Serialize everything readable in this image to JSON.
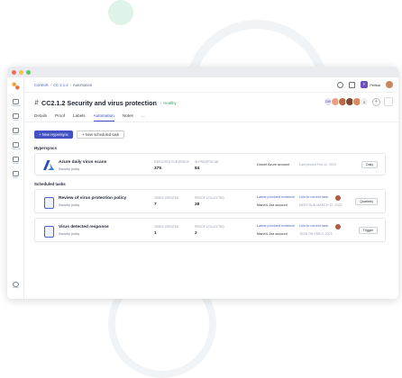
{
  "breadcrumb": {
    "controls": "Controls",
    "control": "CC 2.1.2",
    "current": "Automation"
  },
  "sidebar": {
    "items": [
      {
        "label": "Dashboard",
        "icon": "home-icon"
      },
      {
        "label": "Controls",
        "icon": "shield-icon"
      },
      {
        "label": "Evidence",
        "icon": "folder-icon"
      },
      {
        "label": "Documents",
        "icon": "document-icon"
      },
      {
        "label": "Vendors",
        "icon": "box-icon"
      },
      {
        "label": "Audits",
        "icon": "audit-icon"
      },
      {
        "label": "Settings",
        "icon": "gear-icon"
      }
    ]
  },
  "topbar": {
    "org_badge": "P",
    "org_name": "Pelikai"
  },
  "header": {
    "title": "CC2.1.2 Security and virus protection",
    "status": "Healthy",
    "initials": "DW",
    "more_count": "3"
  },
  "tabs": [
    {
      "label": "Details",
      "active": false
    },
    {
      "label": "Proof",
      "active": false
    },
    {
      "label": "Labels",
      "active": false
    },
    {
      "label": "Automation",
      "active": true
    },
    {
      "label": "Notes",
      "active": false
    },
    {
      "label": "...",
      "active": false
    }
  ],
  "buttons": {
    "new_hypersync": "+ New Hypersync",
    "new_scheduled": "+ New scheduled task"
  },
  "sections": {
    "hypersyncs": "Hypersyncs",
    "scheduled": "Scheduled tasks"
  },
  "hypersync": {
    "name": "Azure daily virus scans",
    "policy": "Security policy",
    "col1_label": "EXECUTED FOR PROOF",
    "col1_value": "375",
    "col2_label": "IN PROOF/SCAN",
    "col2_value": "84",
    "account": "Drovet Azure account",
    "last_run": "Last proved Feb 12, 2023",
    "frequency": "Daily"
  },
  "tasks": [
    {
      "name": "Review of virus protection policy",
      "policy": "Security policy",
      "col1_label": "TASKS CREATED",
      "col1_value": "7",
      "col2_label": "PROOF COLLECTED",
      "col2_value": "28",
      "link1": "Latest provided evidence",
      "link2": "Link to current task",
      "owner": "Maria's Jira account",
      "next": "NEXT RUN MARCH 17, 2023",
      "badge": "Quarterly"
    },
    {
      "name": "Virus detected response",
      "policy": "Security policy",
      "col1_label": "TASKS CREATED",
      "col1_value": "1",
      "col2_label": "PROOF COLLECTED",
      "col2_value": "2",
      "link1": "Latest provided evidence",
      "link2": "Link to current task",
      "owner": "Maria's Jira account",
      "next": "TASK ON FEB 9, 2023",
      "badge": "Trigger"
    }
  ],
  "colors": {
    "accent": "#4252c4",
    "healthy": "#2f9e5c",
    "link": "#4f63c9"
  }
}
